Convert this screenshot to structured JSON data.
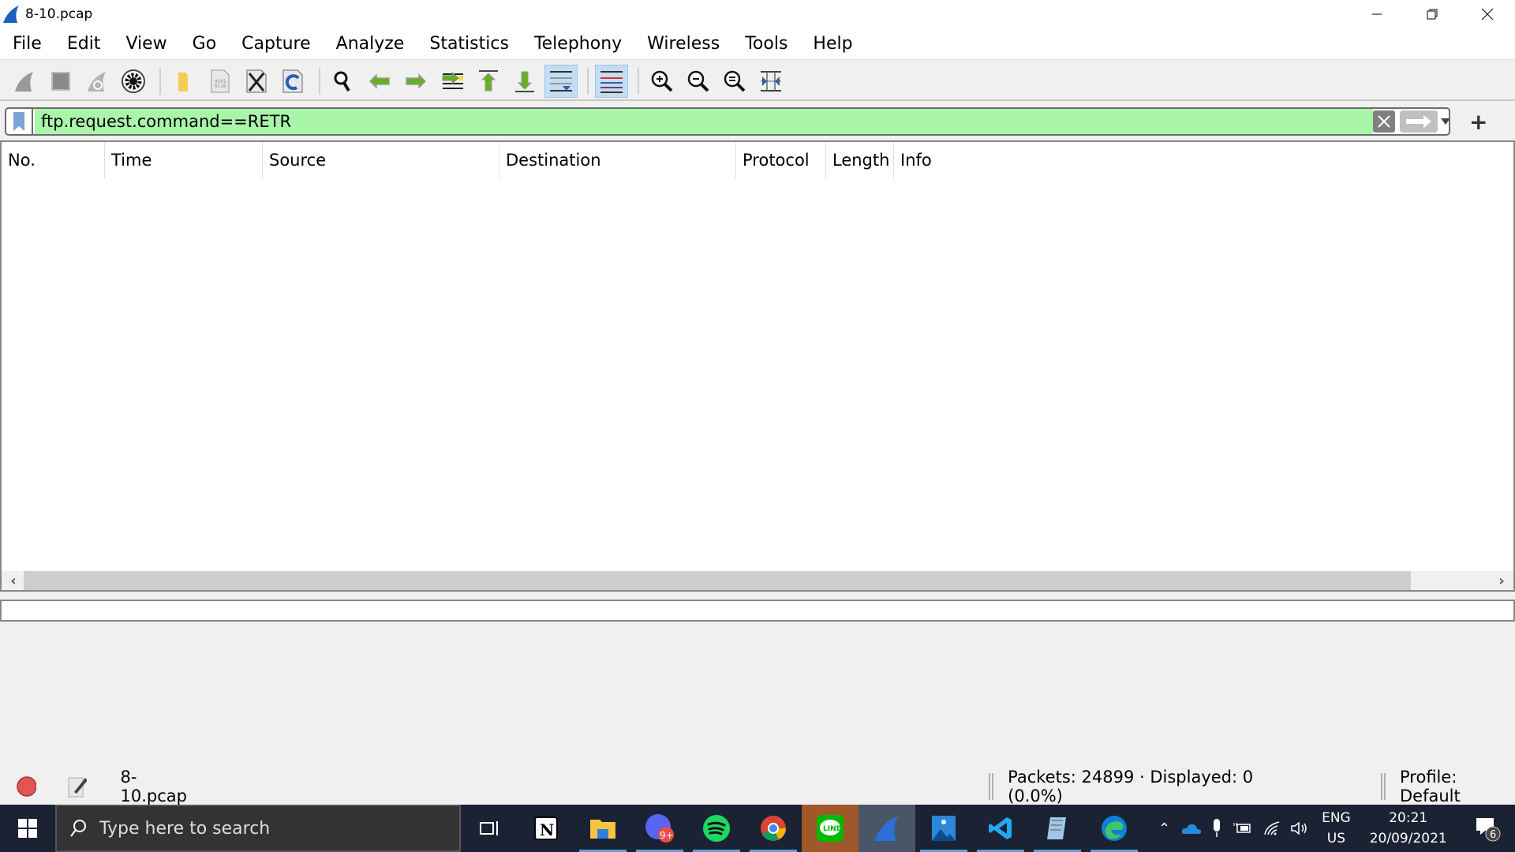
{
  "window": {
    "title": "8-10.pcap",
    "controls": {
      "minimize": "minimize-icon",
      "restore": "restore-icon",
      "close": "close-icon"
    }
  },
  "menu": [
    "File",
    "Edit",
    "View",
    "Go",
    "Capture",
    "Analyze",
    "Statistics",
    "Telephony",
    "Wireless",
    "Tools",
    "Help"
  ],
  "toolbar": {
    "icons": [
      "start-capture-icon",
      "stop-capture-icon",
      "restart-capture-icon",
      "capture-options-icon",
      "open-file-icon",
      "save-file-icon",
      "close-file-icon",
      "reload-file-icon",
      "find-packet-icon",
      "go-back-icon",
      "go-forward-icon",
      "go-to-packet-icon",
      "first-packet-icon",
      "last-packet-icon",
      "auto-scroll-icon",
      "colorize-icon",
      "zoom-in-icon",
      "zoom-out-icon",
      "normal-size-icon",
      "resize-columns-icon"
    ]
  },
  "filter": {
    "value": "ftp.request.command==RETR",
    "bg_color": "#a9f5a9"
  },
  "packet_list": {
    "columns": [
      "No.",
      "Time",
      "Source",
      "Destination",
      "Protocol",
      "Length",
      "Info"
    ],
    "rows": []
  },
  "status": {
    "file": "8-10.pcap",
    "packets": "Packets: 24899 · Displayed: 0 (0.0%)",
    "profile": "Profile: Default"
  },
  "taskbar": {
    "search_placeholder": "Type here to search",
    "apps": [
      "task-view",
      "notion",
      "file-explorer",
      "discord",
      "spotify",
      "chrome",
      "line",
      "wireshark",
      "photos",
      "vscode",
      "notepad",
      "edge"
    ],
    "discord_badge": "9+",
    "lang_top": "ENG",
    "lang_bottom": "US",
    "time": "20:21",
    "date": "20/09/2021",
    "notifications": "6"
  }
}
